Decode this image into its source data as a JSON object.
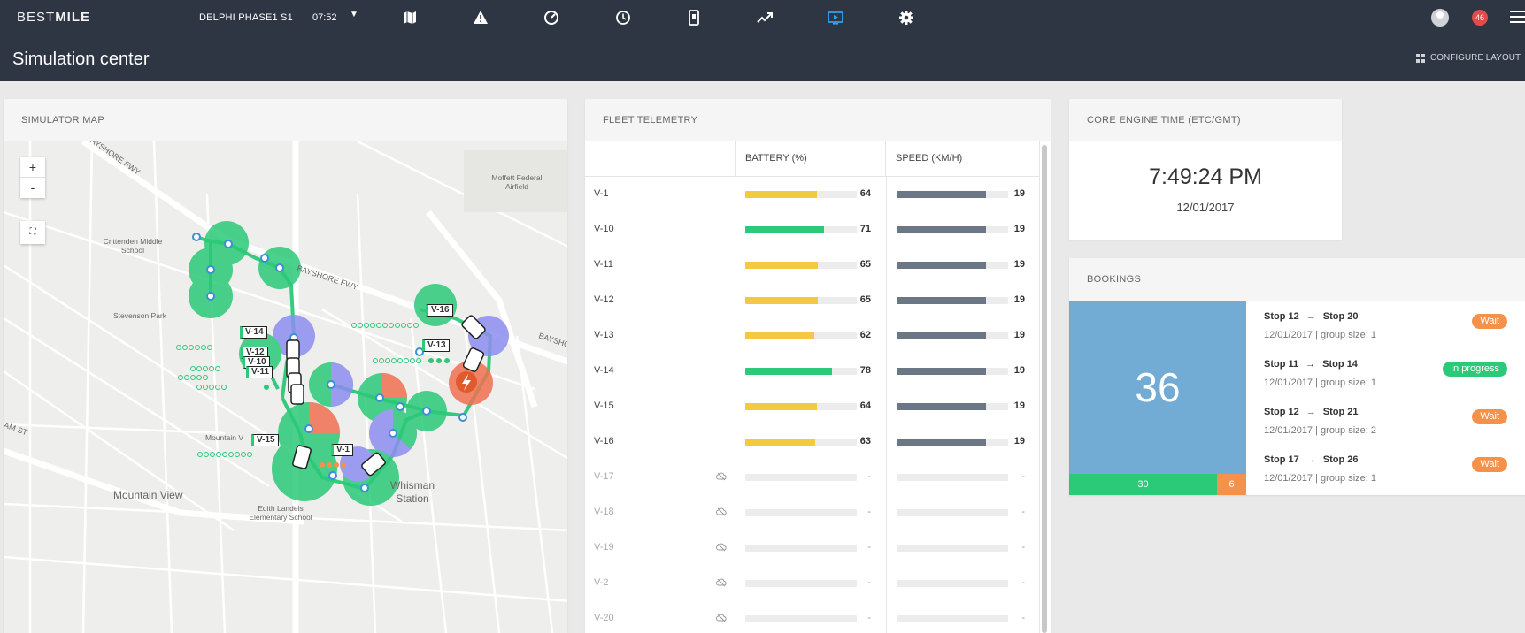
{
  "nav": {
    "logo_light": "BEST",
    "logo_bold": "MILE",
    "project": "DELPHI PHASE1 S1",
    "time": "07:52",
    "notification_count": "46"
  },
  "page": {
    "title": "Simulation center",
    "configure_label": "CONFIGURE LAYOUT"
  },
  "map": {
    "title": "SIMULATOR MAP",
    "zoom_in": "+",
    "zoom_out": "-",
    "labels": {
      "bayshore1": "BAYSHORE FWY",
      "bayshore2": "BAYSHORE FWY",
      "bayshore3": "BAYSHO",
      "moffett": "Moffett Federal Airfield",
      "crittenden": "Crittenden Middle School",
      "stevenson": "Stevenson Park",
      "mountainv": "Mountain V",
      "mountainview": "Mountain View",
      "edith": "Edith Landels Elementary School",
      "whisman": "Whisman Station",
      "street": "AM ST"
    },
    "vehicles": [
      "V-16",
      "V-14",
      "V-13",
      "V-12",
      "V-10",
      "V-11",
      "V-15",
      "V-1"
    ]
  },
  "telemetry": {
    "title": "FLEET TELEMETRY",
    "col_battery": "BATTERY (%)",
    "col_speed": "SPEED (KM/H)",
    "rows": [
      {
        "name": "V-1",
        "battery": "64",
        "speed": "19"
      },
      {
        "name": "V-10",
        "battery": "71",
        "speed": "19"
      },
      {
        "name": "V-11",
        "battery": "65",
        "speed": "19"
      },
      {
        "name": "V-12",
        "battery": "65",
        "speed": "19"
      },
      {
        "name": "V-13",
        "battery": "62",
        "speed": "19"
      },
      {
        "name": "V-14",
        "battery": "78",
        "speed": "19"
      },
      {
        "name": "V-15",
        "battery": "64",
        "speed": "19"
      },
      {
        "name": "V-16",
        "battery": "63",
        "speed": "19"
      },
      {
        "name": "V-17",
        "battery": "-",
        "speed": "-"
      },
      {
        "name": "V-18",
        "battery": "-",
        "speed": "-"
      },
      {
        "name": "V-19",
        "battery": "-",
        "speed": "-"
      },
      {
        "name": "V-2",
        "battery": "-",
        "speed": "-"
      },
      {
        "name": "V-20",
        "battery": "-",
        "speed": "-"
      }
    ],
    "battery_fill": [
      0.64,
      0.71,
      0.65,
      0.65,
      0.62,
      0.78,
      0.64,
      0.63
    ],
    "speed_fill": [
      0.8,
      0.8,
      0.8,
      0.8,
      0.8,
      0.8,
      0.8,
      0.8
    ],
    "colors": {
      "battery_low": "#f3c944",
      "battery_high": "#2bc978",
      "speed": "#6b7785"
    }
  },
  "engine": {
    "title": "CORE ENGINE TIME (ETC/GMT)",
    "time": "7:49:24 PM",
    "date": "12/01/2017"
  },
  "bookings": {
    "title": "BOOKINGS",
    "total": "36",
    "done": "30",
    "pending": "6",
    "items": [
      {
        "from": "Stop 12",
        "to": "Stop 20",
        "date": "12/01/2017",
        "meta": "| group size: 1",
        "status": "Wait"
      },
      {
        "from": "Stop 11",
        "to": "Stop 14",
        "date": "12/01/2017",
        "meta": "| group size: 1",
        "status": "In progress"
      },
      {
        "from": "Stop 12",
        "to": "Stop 21",
        "date": "12/01/2017",
        "meta": "| group size: 2",
        "status": "Wait"
      },
      {
        "from": "Stop 17",
        "to": "Stop 26",
        "date": "12/01/2017",
        "meta": "| group size: 1",
        "status": "Wait"
      }
    ],
    "arrow": "→"
  }
}
